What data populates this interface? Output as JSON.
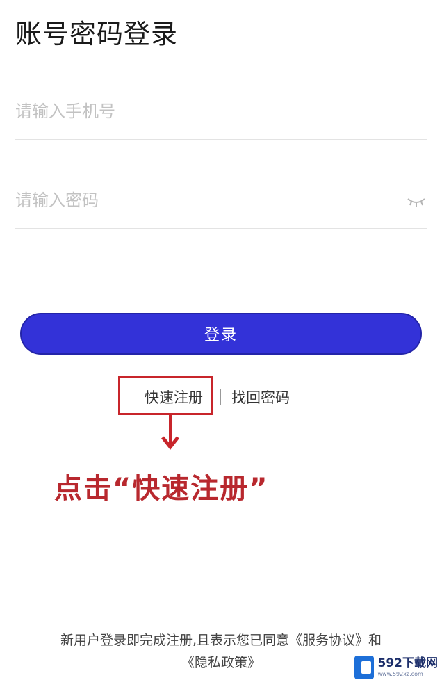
{
  "header": {
    "title": "账号密码登录"
  },
  "form": {
    "phone_placeholder": "请输入手机号",
    "password_placeholder": "请输入密码",
    "login_label": "登录"
  },
  "links": {
    "register": "快速注册",
    "forgot_password": "找回密码"
  },
  "annotation": {
    "text": "点击“快速注册”"
  },
  "footer": {
    "agreement_prefix": "新用户登录即完成注册,且表示您已同意",
    "terms_link": "《服务协议》",
    "conjunction": "和",
    "privacy_link": "《隐私政策》"
  },
  "watermark": {
    "brand": "592下载网",
    "site": "www.592xz.com"
  },
  "colors": {
    "primary_button": "#3332d8",
    "annotation_red": "#c8252b"
  },
  "icons": {
    "password_visibility": "eye-closed-icon",
    "annotation_arrow": "arrow-down-icon"
  }
}
